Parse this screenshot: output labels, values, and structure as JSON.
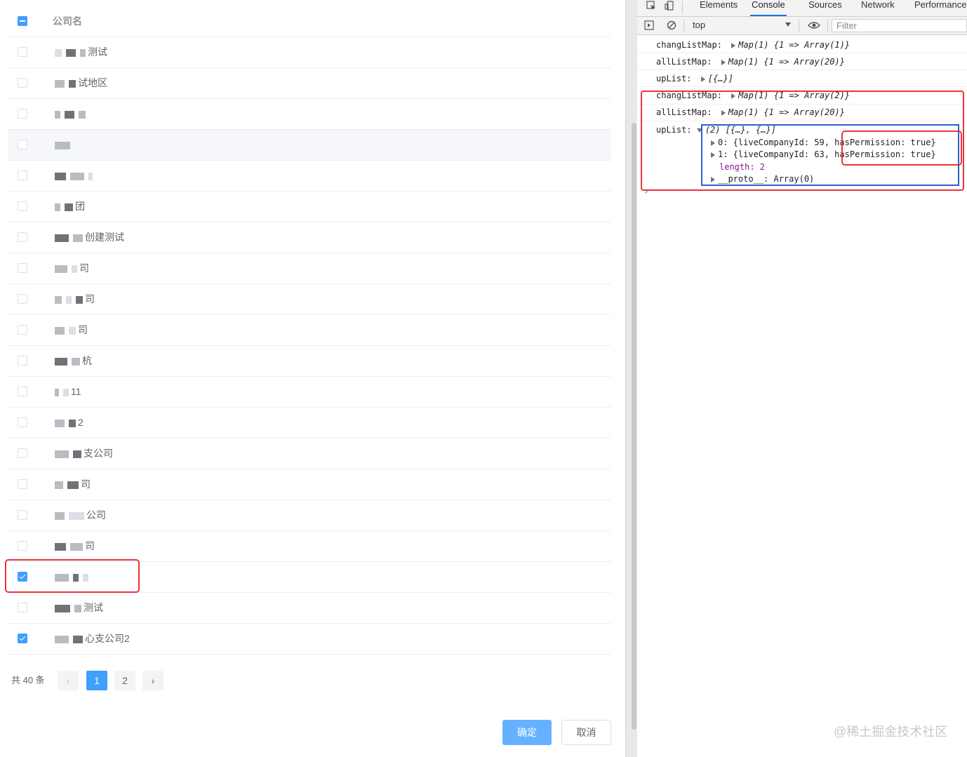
{
  "table": {
    "header": "公司名",
    "rows": [
      {
        "label": "测试",
        "checked": false
      },
      {
        "label": "试地区",
        "checked": false
      },
      {
        "label": "",
        "checked": false
      },
      {
        "label": "",
        "checked": false
      },
      {
        "label": "",
        "checked": false
      },
      {
        "label": "团",
        "checked": false
      },
      {
        "label": "创建测试",
        "checked": false
      },
      {
        "label": "司",
        "checked": false
      },
      {
        "label": "司",
        "checked": false
      },
      {
        "label": "司",
        "checked": false
      },
      {
        "label": "杭",
        "checked": false
      },
      {
        "label": "11",
        "checked": false
      },
      {
        "label": "2",
        "checked": false
      },
      {
        "label": "支公司",
        "checked": false
      },
      {
        "label": "司",
        "checked": false
      },
      {
        "label": "公司",
        "checked": false
      },
      {
        "label": "司",
        "checked": false
      },
      {
        "label": "",
        "checked": true
      },
      {
        "label": "测试",
        "checked": false
      },
      {
        "label": "心支公司2",
        "checked": true
      }
    ]
  },
  "pagination": {
    "total_text": "共 40 条",
    "prev": "‹",
    "next": "›",
    "pages": [
      "1",
      "2"
    ],
    "current": "1"
  },
  "buttons": {
    "confirm": "确定",
    "cancel": "取消"
  },
  "devtools": {
    "tabs": [
      "Elements",
      "Console",
      "Sources",
      "Network",
      "Performance"
    ],
    "active_tab": "Console",
    "context": "top",
    "filter_placeholder": "Filter",
    "logs": [
      {
        "key": "changListMap:",
        "value": "Map(1) {1 => Array(1)}"
      },
      {
        "key": "allListMap:",
        "value": "Map(1) {1 => Array(20)}"
      },
      {
        "key": "upList:",
        "value": "[{…}]"
      },
      {
        "key": "changListMap:",
        "value": "Map(1) {1 => Array(2)}"
      },
      {
        "key": "allListMap:",
        "value": "Map(1) {1 => Array(20)}"
      },
      {
        "key": "upList:",
        "value": "(2) [{…}, {…}]"
      }
    ],
    "expanded": {
      "item0": "0: {liveCompanyId: 59, hasPermission: true}",
      "item1": "1: {liveCompanyId: 63, hasPermission: true}",
      "length": "length: 2",
      "proto": "__proto__: Array(0)"
    },
    "prompt": "›"
  },
  "watermark": "@稀土掘金技术社区"
}
